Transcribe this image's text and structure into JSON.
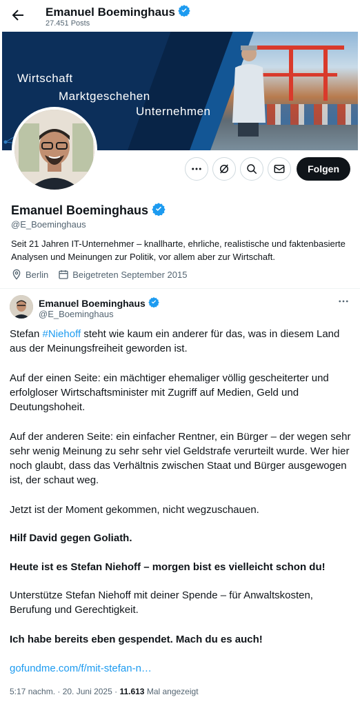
{
  "header": {
    "title": "Emanuel Boeminghaus",
    "posts_count": "27.451 Posts"
  },
  "banner": {
    "line1": "Wirtschaft",
    "line2": "Marktgeschehen",
    "line3": "Unternehmen"
  },
  "profile": {
    "name": "Emanuel Boeminghaus",
    "handle": "@E_Boeminghaus",
    "bio": "Seit 21 Jahren IT-Unternehmer – knallharte, ehrliche, realistische und faktenbasierte Analysen und Meinungen zur Politik, vor allem aber zur Wirtschaft.",
    "location": "Berlin",
    "joined": "Beigetreten September 2015",
    "follow_label": "Folgen"
  },
  "tweet": {
    "author": "Emanuel Boeminghaus",
    "handle": "@E_Boeminghaus",
    "p1_pre": "Stefan ",
    "p1_hashtag": "#Niehoff",
    "p1_post": " steht wie kaum ein anderer für das, was in diesem Land aus der Meinungsfreiheit geworden ist.",
    "p2": "Auf der einen Seite: ein mächtiger ehemaliger völlig gescheiterter und erfolgloser Wirtschaftsminister mit Zugriff auf Medien, Geld und Deutungshoheit.",
    "p3": "Auf der anderen Seite: ein einfacher Rentner, ein Bürger – der wegen sehr sehr wenig Meinung zu sehr sehr viel Geldstrafe verurteilt wurde. Wer hier noch glaubt, dass das Verhältnis zwischen Staat und Bürger ausgewogen ist, der schaut weg.",
    "p4": "Jetzt ist der Moment gekommen, nicht wegzuschauen.",
    "p5": "Hilf David gegen Goliath.",
    "p6": "Heute ist es Stefan Niehoff – morgen bist es vielleicht schon du!",
    "p7": "Unterstütze Stefan Niehoff mit deiner Spende – für Anwaltskosten, Berufung und Gerechtigkeit.",
    "p8": "Ich habe bereits eben gespendet. Mach du es auch!",
    "link": "gofundme.com/f/mit-stefan-n…",
    "timestamp": "5:17 nachm. · 20. Juni 2025 · ",
    "views": "11.613",
    "views_label": " Mal angezeigt"
  },
  "colors": {
    "accent": "#1d9bf0",
    "text": "#0f1419",
    "muted": "#536471",
    "banner": "#0c2f5a"
  },
  "icons": [
    "back-arrow-icon",
    "verified-badge-icon",
    "more-icon",
    "grok-icon",
    "search-icon",
    "message-icon",
    "location-icon",
    "calendar-icon"
  ]
}
